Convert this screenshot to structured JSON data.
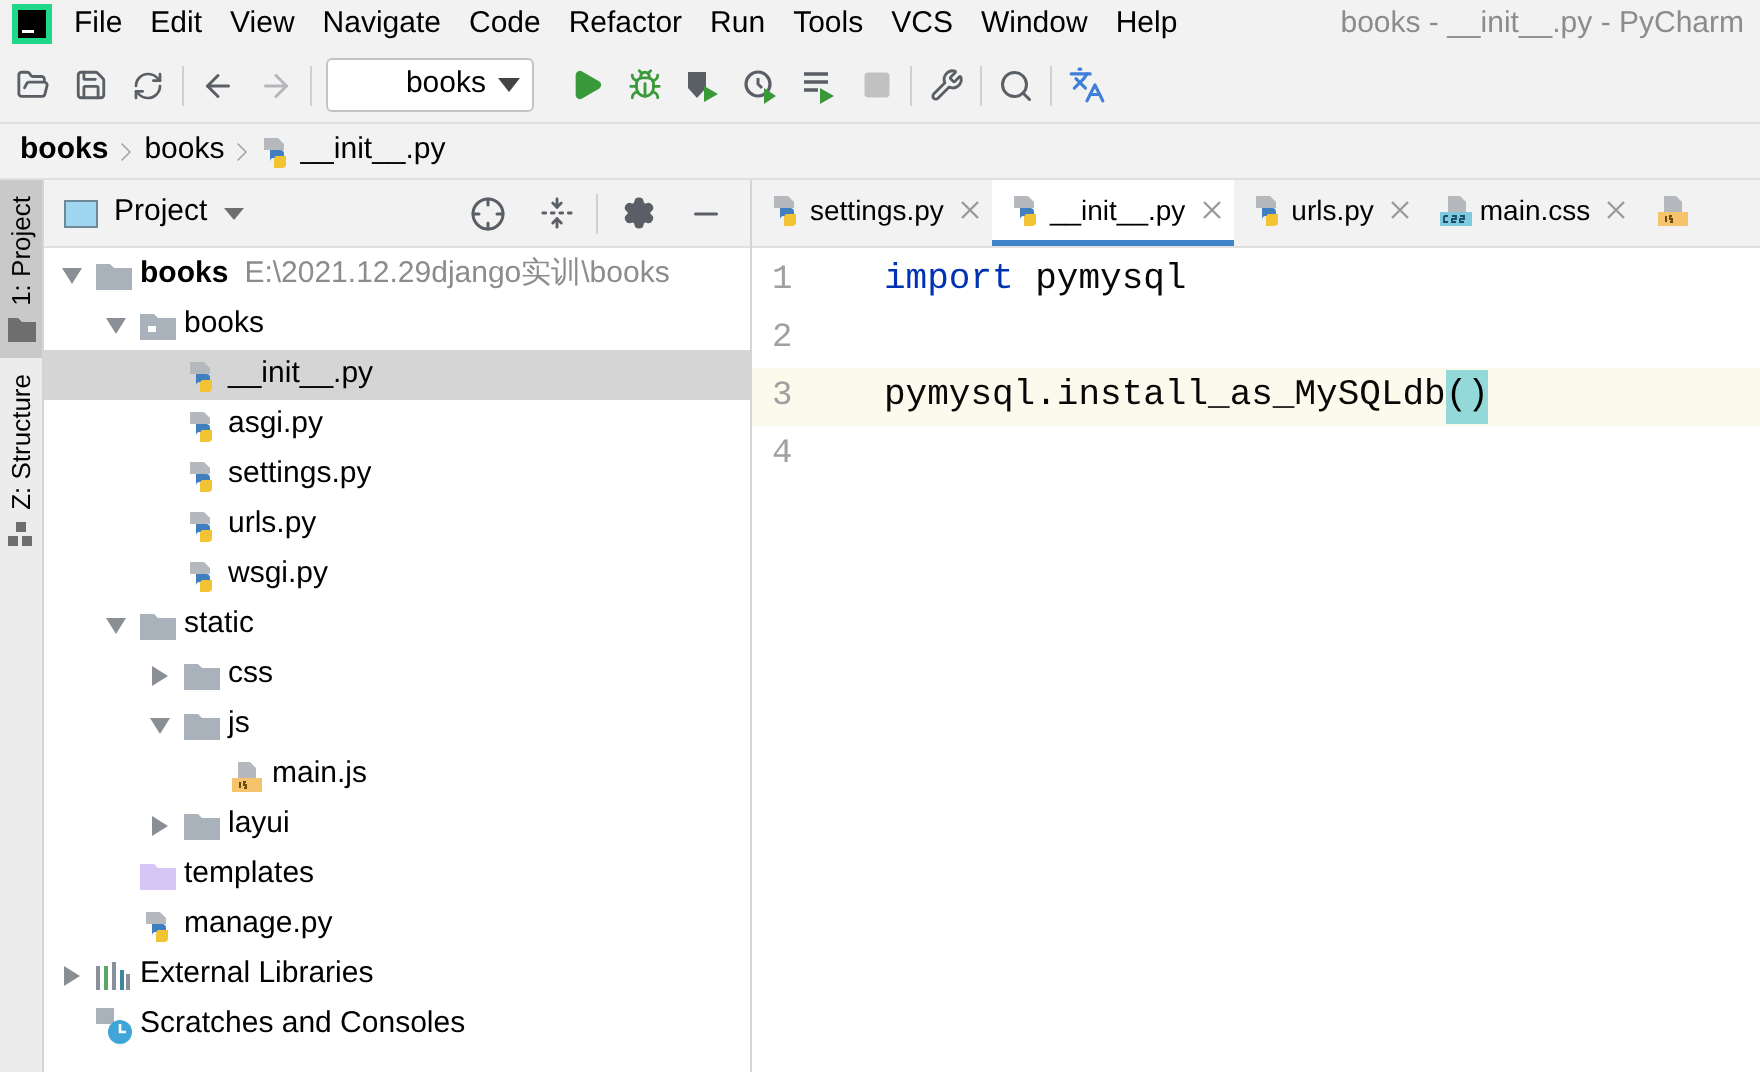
{
  "menu": [
    "File",
    "Edit",
    "View",
    "Navigate",
    "Code",
    "Refactor",
    "Run",
    "Tools",
    "VCS",
    "Window",
    "Help"
  ],
  "window": {
    "title": "books - __init__.py - PyCharm"
  },
  "toolbar": {
    "run_config": "books",
    "forward_disabled": true,
    "stop_disabled": true
  },
  "breadcrumbs": [
    {
      "label": "books",
      "bold": true,
      "kind": "folder"
    },
    {
      "label": "books",
      "bold": false,
      "kind": "folder"
    },
    {
      "label": "__init__.py",
      "bold": false,
      "kind": "python"
    }
  ],
  "side_tabs": [
    {
      "label": "1: Project",
      "selected": true,
      "kind": "folder"
    },
    {
      "label": "Z: Structure",
      "selected": false,
      "kind": "structure"
    }
  ],
  "project_panel": {
    "title": "Project"
  },
  "tree": [
    {
      "label": "books",
      "path": "E:\\2021.12.29django实训\\books",
      "kind": "folder",
      "expanded": true,
      "selected": false,
      "bold": true,
      "children": [
        {
          "label": "books",
          "kind": "package",
          "expanded": true,
          "selected": false,
          "children": [
            {
              "label": "__init__.py",
              "kind": "python",
              "selected": true
            },
            {
              "label": "asgi.py",
              "kind": "python",
              "selected": false
            },
            {
              "label": "settings.py",
              "kind": "python",
              "selected": false
            },
            {
              "label": "urls.py",
              "kind": "python",
              "selected": false
            },
            {
              "label": "wsgi.py",
              "kind": "python",
              "selected": false
            }
          ]
        },
        {
          "label": "static",
          "kind": "folder",
          "expanded": true,
          "selected": false,
          "children": [
            {
              "label": "css",
              "kind": "folder",
              "expanded": false,
              "selected": false
            },
            {
              "label": "js",
              "kind": "folder",
              "expanded": true,
              "selected": false,
              "children": [
                {
                  "label": "main.js",
                  "kind": "js",
                  "selected": false
                }
              ]
            },
            {
              "label": "layui",
              "kind": "folder",
              "expanded": false,
              "selected": false
            }
          ]
        },
        {
          "label": "templates",
          "kind": "templates",
          "selected": false
        },
        {
          "label": "manage.py",
          "kind": "python",
          "selected": false
        }
      ]
    },
    {
      "label": "External Libraries",
      "kind": "libraries",
      "expanded": false,
      "selected": false
    },
    {
      "label": "Scratches and Consoles",
      "kind": "scratches",
      "selected": false
    }
  ],
  "tabs": [
    {
      "label": "settings.py",
      "kind": "python",
      "selected": false
    },
    {
      "label": "__init__.py",
      "kind": "python",
      "selected": true
    },
    {
      "label": "urls.py",
      "kind": "python",
      "selected": false
    },
    {
      "label": "main.css",
      "kind": "css",
      "selected": false
    },
    {
      "kind": "js",
      "selected": false
    }
  ],
  "code": [
    {
      "number": "1",
      "current": false,
      "tokens": [
        {
          "text": "import",
          "kind": "keyword"
        },
        {
          "text": " pymysql",
          "kind": "plain"
        }
      ]
    },
    {
      "number": "2",
      "current": false
    },
    {
      "number": "3",
      "current": true,
      "tokens": [
        {
          "text": "pymysql.install_as_MySQLdb",
          "kind": "plain"
        },
        {
          "text": "()",
          "kind": "match"
        }
      ]
    },
    {
      "number": "4",
      "current": false
    }
  ]
}
